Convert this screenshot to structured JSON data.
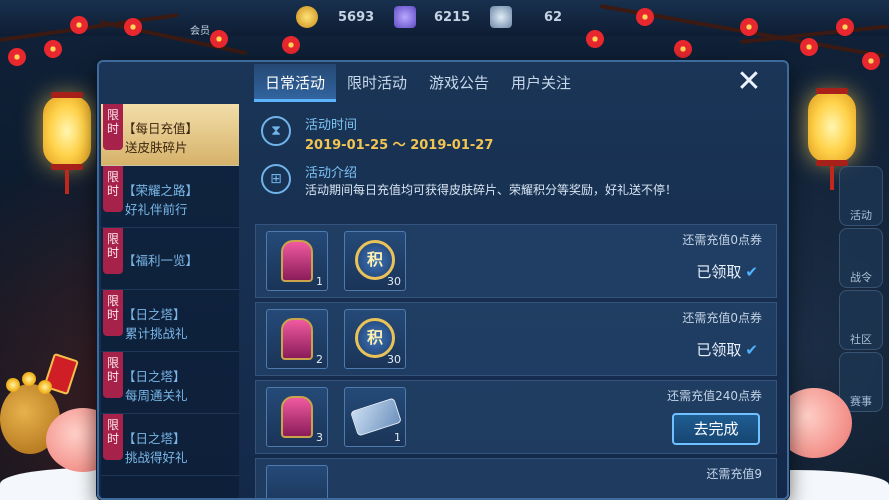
{
  "hud": {
    "gold": "5693",
    "gems": "6215",
    "tokens": "62",
    "menu_label": "会员"
  },
  "dialog": {
    "tabs": [
      {
        "label": "日常活动"
      },
      {
        "label": "限时活动"
      },
      {
        "label": "游戏公告"
      },
      {
        "label": "用户关注"
      }
    ],
    "close_symbol": "✕",
    "limit_tag": "限时",
    "sidebar": [
      {
        "title": "【每日充值】",
        "sub": "送皮肤碎片"
      },
      {
        "title": "【荣耀之路】",
        "sub": "好礼伴前行"
      },
      {
        "title": "【福利一览】",
        "sub": ""
      },
      {
        "title": "【日之塔】",
        "sub": "累计挑战礼"
      },
      {
        "title": "【日之塔】",
        "sub": "每周通关礼"
      },
      {
        "title": "【日之塔】",
        "sub": "挑战得好礼"
      }
    ],
    "activity": {
      "time_label": "活动时间",
      "time_value": "2019-01-25 ～ 2019-01-27",
      "intro_label": "活动介绍",
      "intro_text": "活动期间每日充值均可获得皮肤碎片、荣耀积分等奖励，好礼送不停！"
    },
    "rewards": [
      {
        "requirement": "还需充值0点券",
        "items": [
          {
            "icon": "skin-fragment-icon",
            "count": "1"
          },
          {
            "icon": "honor-points-icon",
            "count": "30"
          }
        ],
        "status": "已领取"
      },
      {
        "requirement": "还需充值0点券",
        "items": [
          {
            "icon": "skin-fragment-icon",
            "count": "2"
          },
          {
            "icon": "honor-points-icon",
            "count": "30"
          }
        ],
        "status": "已领取"
      },
      {
        "requirement": "还需充值240点券",
        "items": [
          {
            "icon": "skin-fragment-icon",
            "count": "3"
          },
          {
            "icon": "ticket-icon",
            "count": "1"
          }
        ],
        "action": "去完成"
      }
    ],
    "partial_row_requirement": "还需充值9",
    "colors": {
      "accent": "#5ab4ff",
      "gold_text": "#f2c552",
      "active_side": "#e8cf8f"
    }
  },
  "right_rail": [
    {
      "label": "活动"
    },
    {
      "label": "战令"
    },
    {
      "label": "社区"
    },
    {
      "label": "赛事"
    }
  ]
}
